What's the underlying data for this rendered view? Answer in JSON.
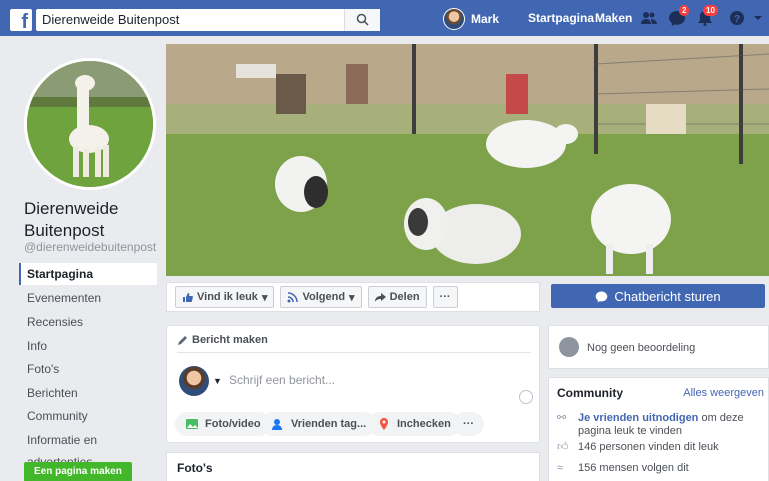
{
  "topbar": {
    "search_value": "Dierenweide Buitenpost",
    "user_name": "Mark",
    "links": [
      "Startpagina",
      "Maken"
    ],
    "badges": {
      "messages": "2",
      "notifications": "10"
    }
  },
  "page": {
    "name": "Dierenweide Buitenpost",
    "handle": "@dierenweidebuitenpost"
  },
  "sidebar": {
    "items": [
      {
        "label": "Startpagina"
      },
      {
        "label": "Evenementen"
      },
      {
        "label": "Recensies"
      },
      {
        "label": "Info"
      },
      {
        "label": "Foto's"
      },
      {
        "label": "Berichten"
      },
      {
        "label": "Community"
      },
      {
        "label": "Informatie en advertenties"
      }
    ],
    "create_page": "Een pagina maken"
  },
  "actions": {
    "like": "Vind ik leuk",
    "follow": "Volgend",
    "share": "Delen",
    "more": "···",
    "chat": "Chatbericht sturen"
  },
  "composer": {
    "header": "Bericht maken",
    "placeholder": "Schrijf een bericht...",
    "photo_video": "Foto/video",
    "tag_friends": "Vrienden tag...",
    "check_in": "Inchecken",
    "more": "···"
  },
  "photos": {
    "title": "Foto's"
  },
  "rating": {
    "text": "Nog geen beoordeling"
  },
  "community": {
    "title": "Community",
    "see_all": "Alles weergeven",
    "invite_link": "Je vrienden uitnodigen",
    "invite_rest": " om deze pagina leuk te vinden",
    "likes": "146 personen vinden dit leuk",
    "follows": "156 mensen volgen dit"
  },
  "colors": {
    "brand": "#4267b2",
    "create_button": "#42b72a",
    "badge": "#fa3e3e"
  }
}
